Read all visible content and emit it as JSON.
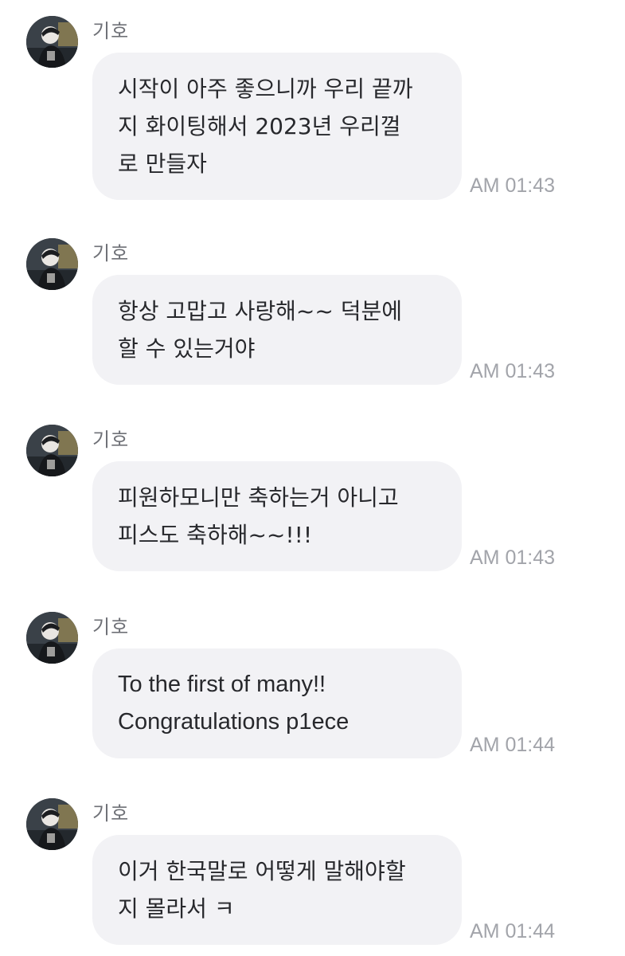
{
  "colors": {
    "bubble_bg": "#f2f2f5",
    "bubble_text": "#27282c",
    "sender_text": "#6f7177",
    "time_text": "#a2a4aa",
    "background": "#ffffff"
  },
  "messages": [
    {
      "sender": "기호",
      "avatar_icon": "profile-photo-icon",
      "text": "시작이 아주 좋으니까 우리 끝까\n지 화이팅해서 2023년 우리껄\n로 만들자",
      "time": "AM 01:43"
    },
    {
      "sender": "기호",
      "avatar_icon": "profile-photo-icon",
      "text": "항상 고맙고 사랑해~~ 덕분에\n할 수 있는거야",
      "time": "AM 01:43"
    },
    {
      "sender": "기호",
      "avatar_icon": "profile-photo-icon",
      "text": "피원하모니만 축하는거 아니고\n피스도 축하해~~!!!",
      "time": "AM 01:43"
    },
    {
      "sender": "기호",
      "avatar_icon": "profile-photo-icon",
      "text": "To the first of many!!\nCongratulations p1ece",
      "time": "AM 01:44"
    },
    {
      "sender": "기호",
      "avatar_icon": "profile-photo-icon",
      "text": "이거 한국말로 어떻게 말해야할\n지 몰라서 ㅋ",
      "time": "AM 01:44"
    }
  ]
}
